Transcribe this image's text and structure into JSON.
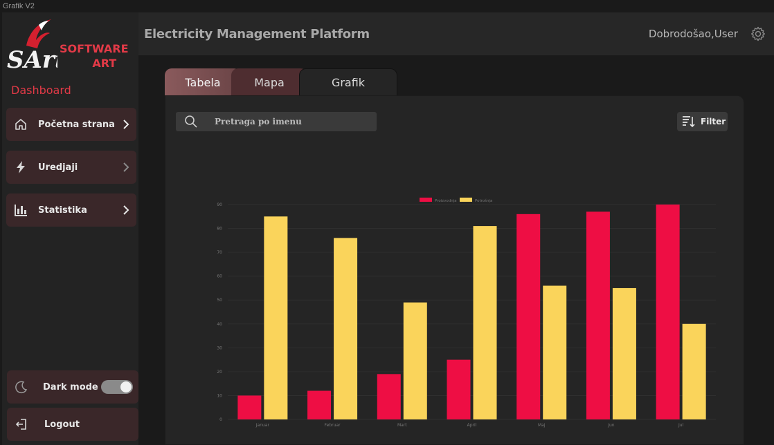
{
  "window": {
    "title": "Grafik V2"
  },
  "brand": {
    "line1": "SOFTWARE",
    "line2": "ART",
    "logo_text": "SArt"
  },
  "sidebar": {
    "section_label": "Dashboard",
    "items": [
      {
        "label": "Početna strana",
        "icon": "home-icon"
      },
      {
        "label": "Uredjaji",
        "icon": "lightning-icon"
      },
      {
        "label": "Statistika",
        "icon": "bar-chart-icon"
      }
    ],
    "dark_mode_label": "Dark mode",
    "dark_mode_on": true,
    "logout_label": "Logout"
  },
  "header": {
    "title": "Electricity Management Platform",
    "greeting": "Dobrodošao,User"
  },
  "tabs": [
    {
      "label": "Tabela",
      "active": false
    },
    {
      "label": "Mapa",
      "active": false
    },
    {
      "label": "Grafik",
      "active": true
    }
  ],
  "search": {
    "placeholder": "Pretraga po imenu"
  },
  "filter": {
    "label": "Filter"
  },
  "colors": {
    "accent": "#e23a47",
    "series1": "#ee0e44",
    "series2": "#fad45b",
    "nav_bg": "#3a2729"
  },
  "chart_data": {
    "type": "bar",
    "categories": [
      "Januar",
      "Februar",
      "Mart",
      "April",
      "Maj",
      "Jun",
      "Jul"
    ],
    "series": [
      {
        "name": "Proizvodnja",
        "color": "#ee0e44",
        "values": [
          10,
          12,
          19,
          25,
          86,
          87,
          90
        ]
      },
      {
        "name": "Potrošnja",
        "color": "#fad45b",
        "values": [
          85,
          76,
          49,
          81,
          56,
          55,
          40
        ]
      }
    ],
    "ylim": [
      0,
      90
    ],
    "yticks": [
      0,
      10,
      20,
      30,
      40,
      50,
      60,
      70,
      80,
      90
    ],
    "legend": "top-center",
    "grid": true
  }
}
